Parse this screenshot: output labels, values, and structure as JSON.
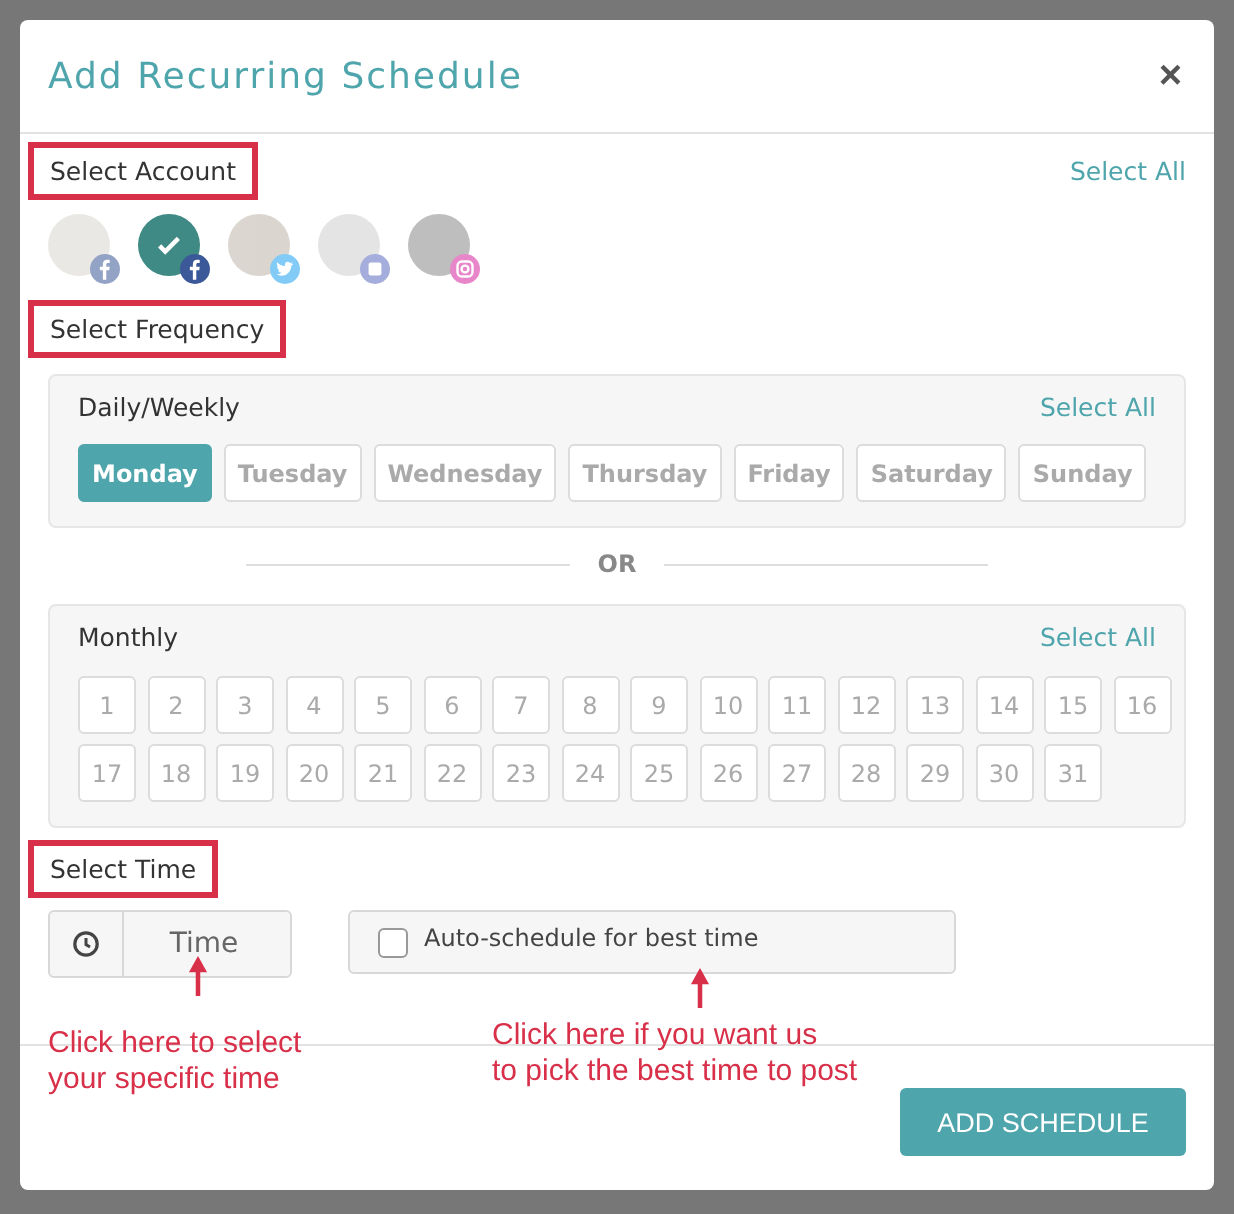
{
  "modal": {
    "title": "Add Recurring Schedule",
    "close": "×"
  },
  "account_section": {
    "label": "Select Account",
    "highlighted": true,
    "select_all": "Select All",
    "accounts": [
      {
        "kind": "facebook",
        "selected": false
      },
      {
        "kind": "facebook",
        "selected": true
      },
      {
        "kind": "twitter",
        "selected": false
      },
      {
        "kind": "page",
        "selected": false
      },
      {
        "kind": "instagram",
        "selected": false
      }
    ]
  },
  "frequency_section": {
    "label": "Select Frequency",
    "highlighted": true,
    "weekly": {
      "title": "Daily/Weekly",
      "select_all": "Select All",
      "days": [
        {
          "label": "Monday",
          "selected": true
        },
        {
          "label": "Tuesday",
          "selected": false
        },
        {
          "label": "Wednesday",
          "selected": false
        },
        {
          "label": "Thursday",
          "selected": false
        },
        {
          "label": "Friday",
          "selected": false
        },
        {
          "label": "Saturday",
          "selected": false
        },
        {
          "label": "Sunday",
          "selected": false
        }
      ]
    },
    "separator": "OR",
    "monthly": {
      "title": "Monthly",
      "select_all": "Select All",
      "days": [
        {
          "label": "1",
          "selected": false
        },
        {
          "label": "2",
          "selected": false
        },
        {
          "label": "3",
          "selected": false
        },
        {
          "label": "4",
          "selected": false
        },
        {
          "label": "5",
          "selected": false
        },
        {
          "label": "6",
          "selected": false
        },
        {
          "label": "7",
          "selected": false
        },
        {
          "label": "8",
          "selected": false
        },
        {
          "label": "9",
          "selected": false
        },
        {
          "label": "10",
          "selected": false
        },
        {
          "label": "11",
          "selected": false
        },
        {
          "label": "12",
          "selected": false
        },
        {
          "label": "13",
          "selected": false
        },
        {
          "label": "14",
          "selected": false
        },
        {
          "label": "15",
          "selected": false
        },
        {
          "label": "16",
          "selected": false
        },
        {
          "label": "17",
          "selected": false
        },
        {
          "label": "18",
          "selected": false
        },
        {
          "label": "19",
          "selected": false
        },
        {
          "label": "20",
          "selected": false
        },
        {
          "label": "21",
          "selected": false
        },
        {
          "label": "22",
          "selected": false
        },
        {
          "label": "23",
          "selected": false
        },
        {
          "label": "24",
          "selected": false
        },
        {
          "label": "25",
          "selected": false
        },
        {
          "label": "26",
          "selected": false
        },
        {
          "label": "27",
          "selected": false
        },
        {
          "label": "28",
          "selected": false
        },
        {
          "label": "29",
          "selected": false
        },
        {
          "label": "30",
          "selected": false
        },
        {
          "label": "31",
          "selected": false
        }
      ]
    }
  },
  "time_section": {
    "label": "Select Time",
    "highlighted": true,
    "time_placeholder": "Time",
    "auto_schedule": {
      "label": "Auto-schedule for best time",
      "checked": false
    }
  },
  "annotations": [
    {
      "lines": [
        "Click here to select",
        "your specific time"
      ]
    },
    {
      "lines": [
        "Click here if you want us",
        "to pick the best time to post"
      ]
    }
  ],
  "footer": {
    "button": "ADD SCHEDULE"
  }
}
